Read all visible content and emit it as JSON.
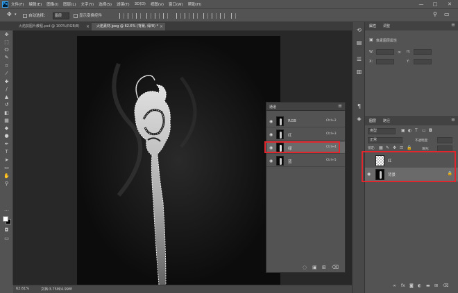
{
  "app": {
    "logo": "Ps"
  },
  "menu": [
    "文件(F)",
    "编辑(E)",
    "图像(I)",
    "图层(L)",
    "文字(Y)",
    "选择(S)",
    "滤镜(T)",
    "3D(D)",
    "视图(V)",
    "窗口(W)",
    "帮助(H)"
  ],
  "window_controls": {
    "minimize": "—",
    "maximize": "□",
    "close": "✕"
  },
  "options_bar": {
    "auto_select_label": "自动选择：",
    "auto_select_value": "图层",
    "show_transform_label": "显示变换控件"
  },
  "tabs": [
    {
      "label": "火焰剪图片教程.psd @ 100%(RGB/8)",
      "active": false,
      "close": "×"
    },
    {
      "label": "火焰素材.jpeg @ 62.6% (背景, 绿/8) *",
      "active": true,
      "close": "×"
    }
  ],
  "tools": [
    {
      "icon": "move-icon",
      "glyph": "✥"
    },
    {
      "icon": "marquee-icon",
      "glyph": "⬚"
    },
    {
      "icon": "lasso-icon",
      "glyph": "ⵔ"
    },
    {
      "icon": "quick-select-icon",
      "glyph": "✎"
    },
    {
      "icon": "crop-icon",
      "glyph": "⌗"
    },
    {
      "icon": "eyedropper-icon",
      "glyph": "⁄"
    },
    {
      "icon": "healing-icon",
      "glyph": "✚"
    },
    {
      "icon": "brush-icon",
      "glyph": "∕"
    },
    {
      "icon": "stamp-icon",
      "glyph": "▲"
    },
    {
      "icon": "history-brush-icon",
      "glyph": "↺"
    },
    {
      "icon": "eraser-icon",
      "glyph": "◧"
    },
    {
      "icon": "gradient-icon",
      "glyph": "▦"
    },
    {
      "icon": "blur-icon",
      "glyph": "◆"
    },
    {
      "icon": "dodge-icon",
      "glyph": "●"
    },
    {
      "icon": "pen-icon",
      "glyph": "✒"
    },
    {
      "icon": "type-icon",
      "glyph": "T"
    },
    {
      "icon": "path-select-icon",
      "glyph": "➤"
    },
    {
      "icon": "shape-icon",
      "glyph": "▭"
    },
    {
      "icon": "hand-icon",
      "glyph": "✋"
    },
    {
      "icon": "zoom-icon",
      "glyph": "⚲"
    },
    {
      "icon": "more-tools-icon",
      "glyph": "…"
    }
  ],
  "status": {
    "zoom": "62.61%",
    "doc": "文档:3.75M/4.99M"
  },
  "channels_panel": {
    "title": "通道",
    "rows": [
      {
        "name": "RGB",
        "shortcut": "Ctrl+2"
      },
      {
        "name": "红",
        "shortcut": "Ctrl+3"
      },
      {
        "name": "绿",
        "shortcut": "Ctrl+4"
      },
      {
        "name": "蓝",
        "shortcut": "Ctrl+5"
      }
    ]
  },
  "properties_panel": {
    "tabs": [
      "属性",
      "调整"
    ],
    "section": "像素图层属性",
    "fields": {
      "w": "W:",
      "h": "H:",
      "x": "X:",
      "y": "Y:"
    }
  },
  "layers_panel": {
    "tabs": [
      "图层",
      "路径"
    ],
    "filter_kind": "类型",
    "blend_mode": "正常",
    "opacity_label": "不透明度:",
    "lock_label": "锁定:",
    "fill_label": "填充:",
    "layers": [
      {
        "name": "红",
        "locked": false
      },
      {
        "name": "背景",
        "locked": true
      }
    ]
  },
  "colors": {
    "highlight": "#e2262d",
    "panel": "#535353",
    "canvas": "#282828"
  }
}
